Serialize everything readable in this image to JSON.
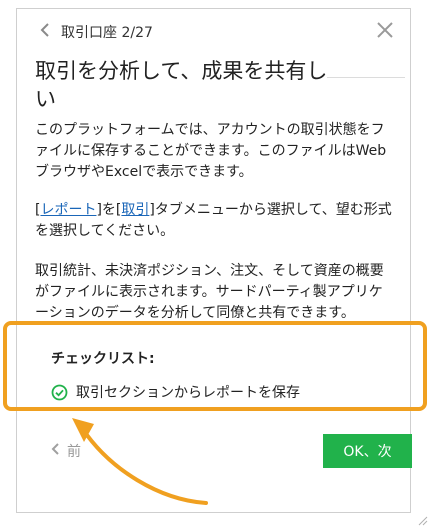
{
  "header": {
    "step_label": "取引口座 2/27"
  },
  "title": {
    "line1": "取引を分析して、成果を共有し",
    "line2": "い"
  },
  "body": {
    "p1": "このプラットフォームでは、アカウントの取引状態をファイルに保存することができます。このファイルはWebブラウザやExcelで表示できます。",
    "p2_bracket_open": "[",
    "p2_link1": "レポート",
    "p2_mid": "]を[",
    "p2_link2": "取引",
    "p2_rest": "]タブメニューから選択して、望む形式を選択してください。",
    "p3": "取引統計、未決済ポジション、注文、そして資産の概要がファイルに表示されます。サードパーティ製アプリケーションのデータを分析して同僚と共有できます。"
  },
  "checklist": {
    "heading": "チェックリスト:",
    "items": [
      {
        "label": "取引セクションからレポートを保存",
        "done": true
      }
    ]
  },
  "footer": {
    "prev_label": "前",
    "next_label": "OK、次"
  },
  "colors": {
    "accent_green": "#21b24b",
    "highlight_orange": "#f0a020",
    "link_blue": "#1a66b8"
  },
  "icons": {
    "back": "chevron-left-icon",
    "close": "close-icon",
    "check": "check-circle-icon",
    "prev": "chevron-left-icon"
  }
}
